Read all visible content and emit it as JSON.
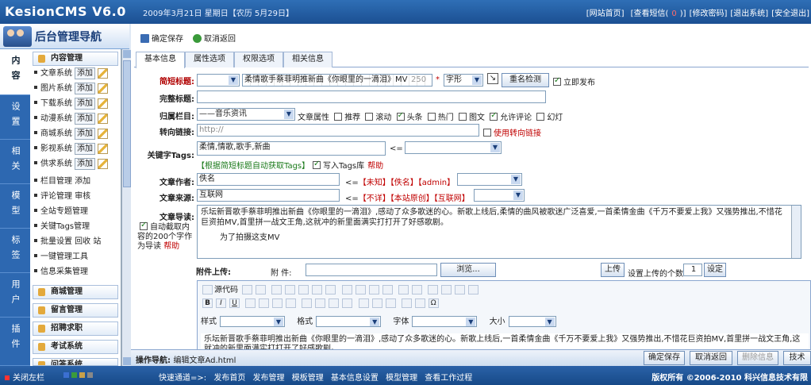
{
  "header": {
    "logo": "KesionCMS V6.0",
    "date": "2009年3月21日 星期日【农历 5月29日】",
    "links": [
      "[网站首页]",
      "[查看短信(",
      "0",
      ")]",
      "[修改密码]",
      "[退出系统]",
      "[安全退出]"
    ]
  },
  "nav": {
    "title": "后台管理导航",
    "vtabs": [
      "内容",
      "设置",
      "相关",
      "模型",
      "标签",
      "用户",
      "插件"
    ],
    "content_group": "内容管理",
    "systems": [
      {
        "name": "文章系统",
        "add": "添加"
      },
      {
        "name": "图片系统",
        "add": "添加"
      },
      {
        "name": "下载系统",
        "add": "添加"
      },
      {
        "name": "动漫系统",
        "add": "添加"
      },
      {
        "name": "商城系统",
        "add": "添加"
      },
      {
        "name": "影视系统",
        "add": "添加"
      },
      {
        "name": "供求系统",
        "add": "添加"
      }
    ],
    "links": [
      "栏目管理 添加",
      "评论管理 审核",
      "全站专题管理",
      "关键Tags管理",
      "批量设置 回收 站",
      "一键管理工具",
      "信息采集管理"
    ],
    "groups": [
      "商城管理",
      "留言管理",
      "招聘求职",
      "考试系统",
      "问答系统"
    ]
  },
  "toolbar": {
    "save": "确定保存",
    "cancel": "取消返回"
  },
  "tabs": [
    "基本信息",
    "属性选项",
    "权限选项",
    "相关信息"
  ],
  "form": {
    "short_title_label": "简短标题:",
    "short_title_value": "柔情歌手蔡菲明推新曲《你眼里的一滴泪》MV",
    "ruler_mid": "250",
    "font_select": "字形",
    "check_button": "重名检测",
    "publish_now": "立即发布",
    "full_title_label": "完整标题:",
    "category_label": "归属栏目:",
    "category_value": "——音乐资讯",
    "attr_label": "文章属性",
    "attrs": [
      {
        "label": "推荐",
        "on": false
      },
      {
        "label": "滚动",
        "on": false
      },
      {
        "label": "头条",
        "on": true
      },
      {
        "label": "热门",
        "on": false
      },
      {
        "label": "图文",
        "on": false
      },
      {
        "label": "允许评论",
        "on": true
      },
      {
        "label": "幻灯",
        "on": false
      }
    ],
    "redirect_label": "转向链接:",
    "redirect_value": "http://",
    "redirect_check": "使用转向链接",
    "tags_label": "关键字Tags:",
    "tags_value": "柔情,情歌,歌手,新曲",
    "tags_arrow": "<=",
    "tags_auto": "【根据简短标题自动获取Tags】",
    "tags_write": "写入Tags库",
    "tags_help": "帮助",
    "author_label": "文章作者:",
    "author_value": "佚名",
    "author_arrow": "<=",
    "author_opts": [
      "【未知】",
      "【佚名】",
      "【admin】"
    ],
    "source_label": "文章来源:",
    "source_value": "互联网",
    "source_arrow": "<=",
    "source_opts": [
      "【不详】",
      "【本站原创】",
      "【互联网】"
    ],
    "summary_label": "文章导读:",
    "summary_auto": "自动截取内容的200个字作为导读",
    "summary_help": "帮助",
    "summary_text": "乐坛新晋歌手蔡菲明推出新曲《你眼里的一滴泪》,感动了众多歌迷的心。新歌上线后,柔情的曲风被歌迷广泛喜爱,一首柔情金曲《千万不要爱上我》又强势推出,不惜花巨资拍MV,首里拼一战文王角,这就冲的新里面满实打打开了好感歌剧。",
    "summary_text2": "为了拍摄这支MV",
    "attach_label": "附件上传:",
    "attach_sub": "附 件:",
    "browse": "浏览...",
    "upload": "上传",
    "upload_count_label": "设置上传的个数",
    "upload_count": "1",
    "confirm": "设定"
  },
  "editor": {
    "source": "源代码",
    "style": "样式",
    "format": "格式",
    "font": "字体",
    "size": "大小",
    "content": "乐坛新晋歌手蔡菲明推出新曲《你眼里的一滴泪》,感动了众多歌迷的心。新歌上线后,一首柔情金曲《千万不要爱上我》又强势推出,不惜花巨资拍MV,首里拼一战文王角,这就冲的新里面满实打打开了好感歌剧。"
  },
  "opnav": {
    "label": "操作导航:",
    "value": "编辑文章Ad.html",
    "save": "确定保存",
    "cancel": "取消返回",
    "delete": "删除信息",
    "tech": "技术"
  },
  "bottom": {
    "close": "关闭左栏",
    "quick_label": "快速通道=>:",
    "quick": [
      "发布首页",
      "发布管理",
      "模板管理",
      "基本信息设置",
      "模型管理",
      "查看工作过程"
    ],
    "copyright": "版权所有 ©2006-2010 科兴信息技术有限"
  }
}
